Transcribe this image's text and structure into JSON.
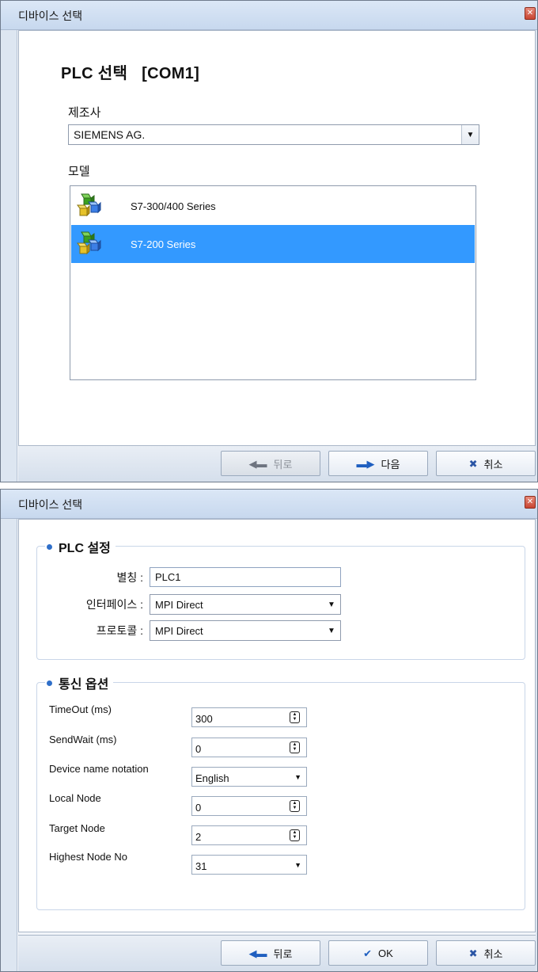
{
  "dialog1": {
    "title": "디바이스 선택",
    "close": "✕",
    "heading": "PLC 선택",
    "port": "[COM1]",
    "manufacturer_label": "제조사",
    "manufacturer_value": "SIEMENS AG.",
    "model_label": "모델",
    "models": [
      {
        "label": "S7-300/400 Series",
        "selected": false
      },
      {
        "label": "S7-200 Series",
        "selected": true
      }
    ],
    "buttons": {
      "back": "뒤로",
      "next": "다음",
      "cancel": "취소"
    }
  },
  "dialog2": {
    "title": "디바이스 선택",
    "close": "✕",
    "plc_group_title": "PLC 설정",
    "alias_label": "별칭 :",
    "alias_value": "PLC1",
    "interface_label": "인터페이스 :",
    "interface_value": "MPI Direct",
    "protocol_label": "프로토콜 :",
    "protocol_value": "MPI Direct",
    "comm_group_title": "통신 옵션",
    "options": {
      "timeout": {
        "label": "TimeOut (ms)",
        "value": "300"
      },
      "sendwait": {
        "label": "SendWait (ms)",
        "value": "0"
      },
      "device_name_notation": {
        "label": "Device name notation",
        "value": "English"
      },
      "local_node": {
        "label": "Local Node",
        "value": "0"
      },
      "target_node": {
        "label": "Target Node",
        "value": "2"
      },
      "highest_node": {
        "label": "Highest Node No",
        "value": "31"
      }
    },
    "buttons": {
      "back": "뒤로",
      "ok": "OK",
      "cancel": "취소"
    }
  },
  "icons": {
    "back": "back-arrow-icon",
    "next": "next-arrow-icon",
    "ok": "checkmark-icon",
    "cancel": "x-icon",
    "model": "plc-cubes-icon",
    "spin": "spin-updown-icon",
    "dropdown": "chevron-down-icon"
  }
}
